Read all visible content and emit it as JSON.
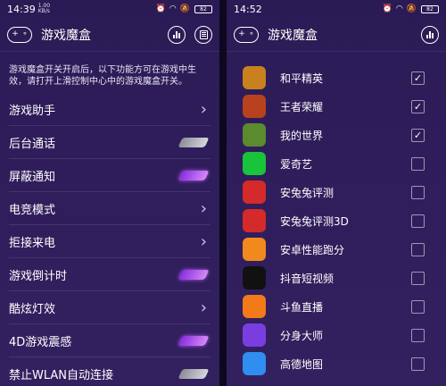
{
  "left": {
    "status": {
      "time": "14:39",
      "net_speed": "1.00",
      "net_unit": "KB/s",
      "battery": "82"
    },
    "title": "游戏魔盒",
    "description": "游戏魔盒开关开启后，以下功能方可在游戏中生效，请打开上滑控制中心中的游戏魔盒开关。",
    "settings": [
      {
        "label": "游戏助手",
        "control": "chevron"
      },
      {
        "label": "后台通话",
        "control": "toggle",
        "state": "off"
      },
      {
        "label": "屏蔽通知",
        "control": "toggle",
        "state": "on"
      },
      {
        "label": "电竞模式",
        "control": "chevron"
      },
      {
        "label": "拒接来电",
        "control": "chevron"
      },
      {
        "label": "游戏倒计时",
        "control": "toggle",
        "state": "on"
      },
      {
        "label": "酷炫灯效",
        "control": "chevron"
      },
      {
        "label": "4D游戏震感",
        "control": "toggle",
        "state": "on"
      },
      {
        "label": "禁止WLAN自动连接",
        "control": "toggle",
        "state": "off"
      }
    ]
  },
  "right": {
    "status": {
      "time": "14:52",
      "battery": "82"
    },
    "title": "游戏魔盒",
    "apps": [
      {
        "name": "和平精英",
        "checked": true,
        "icon": "peace-elite-icon",
        "color": "#c9801e"
      },
      {
        "name": "王者荣耀",
        "checked": true,
        "icon": "honor-of-kings-icon",
        "color": "#b8421e"
      },
      {
        "name": "我的世界",
        "checked": true,
        "icon": "minecraft-icon",
        "color": "#5c8a2e"
      },
      {
        "name": "爱奇艺",
        "checked": false,
        "icon": "iqiyi-icon",
        "color": "#19c43a"
      },
      {
        "name": "安兔兔评测",
        "checked": false,
        "icon": "antutu-icon",
        "color": "#d42a2a"
      },
      {
        "name": "安兔兔评测3D",
        "checked": false,
        "icon": "antutu-3d-icon",
        "color": "#d42a2a"
      },
      {
        "name": "安卓性能跑分",
        "checked": false,
        "icon": "benchmark-icon",
        "color": "#f08a1e"
      },
      {
        "name": "抖音短视频",
        "checked": false,
        "icon": "douyin-icon",
        "color": "#111111"
      },
      {
        "name": "斗鱼直播",
        "checked": false,
        "icon": "douyu-icon",
        "color": "#f27a18"
      },
      {
        "name": "分身大师",
        "checked": false,
        "icon": "clone-master-icon",
        "color": "#7a3ee0"
      },
      {
        "name": "高德地图",
        "checked": false,
        "icon": "amap-icon",
        "color": "#2f8ef0"
      }
    ]
  }
}
